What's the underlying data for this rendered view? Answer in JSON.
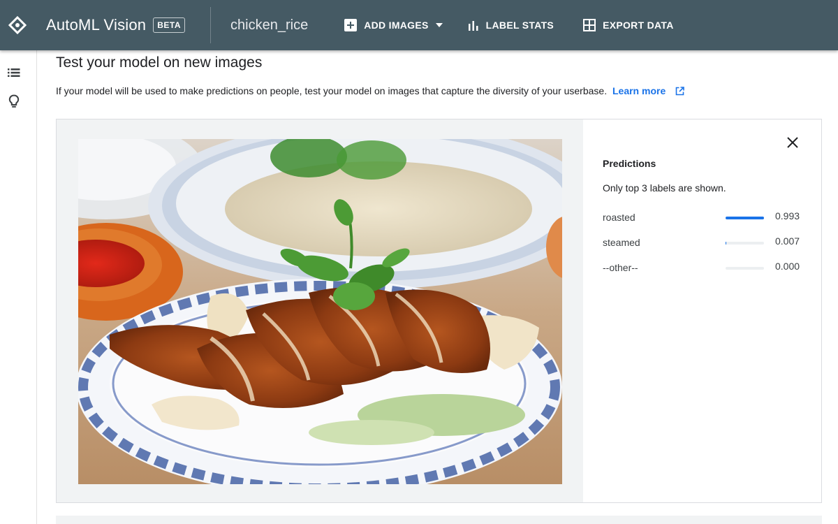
{
  "header": {
    "app_title": "AutoML Vision",
    "badge": "BETA",
    "dataset_name": "chicken_rice",
    "nav": {
      "add_images": "ADD IMAGES",
      "label_stats": "LABEL STATS",
      "export_data": "EXPORT DATA"
    },
    "icons": [
      "automl-logo-icon",
      "add-box-icon",
      "dropdown-caret-icon",
      "bar-chart-icon",
      "grid-icon"
    ]
  },
  "sidebar": {
    "icons": [
      "list-icon",
      "lightbulb-icon"
    ]
  },
  "main": {
    "title": "Test your model on new images",
    "description": "If your model will be used to make predictions on people, test your model on images that capture the diversity of your userbase.",
    "learn_more": "Learn more"
  },
  "predictions": {
    "title": "Predictions",
    "subtitle": "Only top 3 labels are shown.",
    "items": [
      {
        "label": "roasted",
        "value": "0.993",
        "score": 0.993
      },
      {
        "label": "steamed",
        "value": "0.007",
        "score": 0.007
      },
      {
        "label": "--other--",
        "value": "0.000",
        "score": 0.0
      }
    ]
  },
  "colors": {
    "header_bg": "#455a64",
    "accent": "#1a73e8",
    "image_panel_bg": "#f1f3f4"
  }
}
